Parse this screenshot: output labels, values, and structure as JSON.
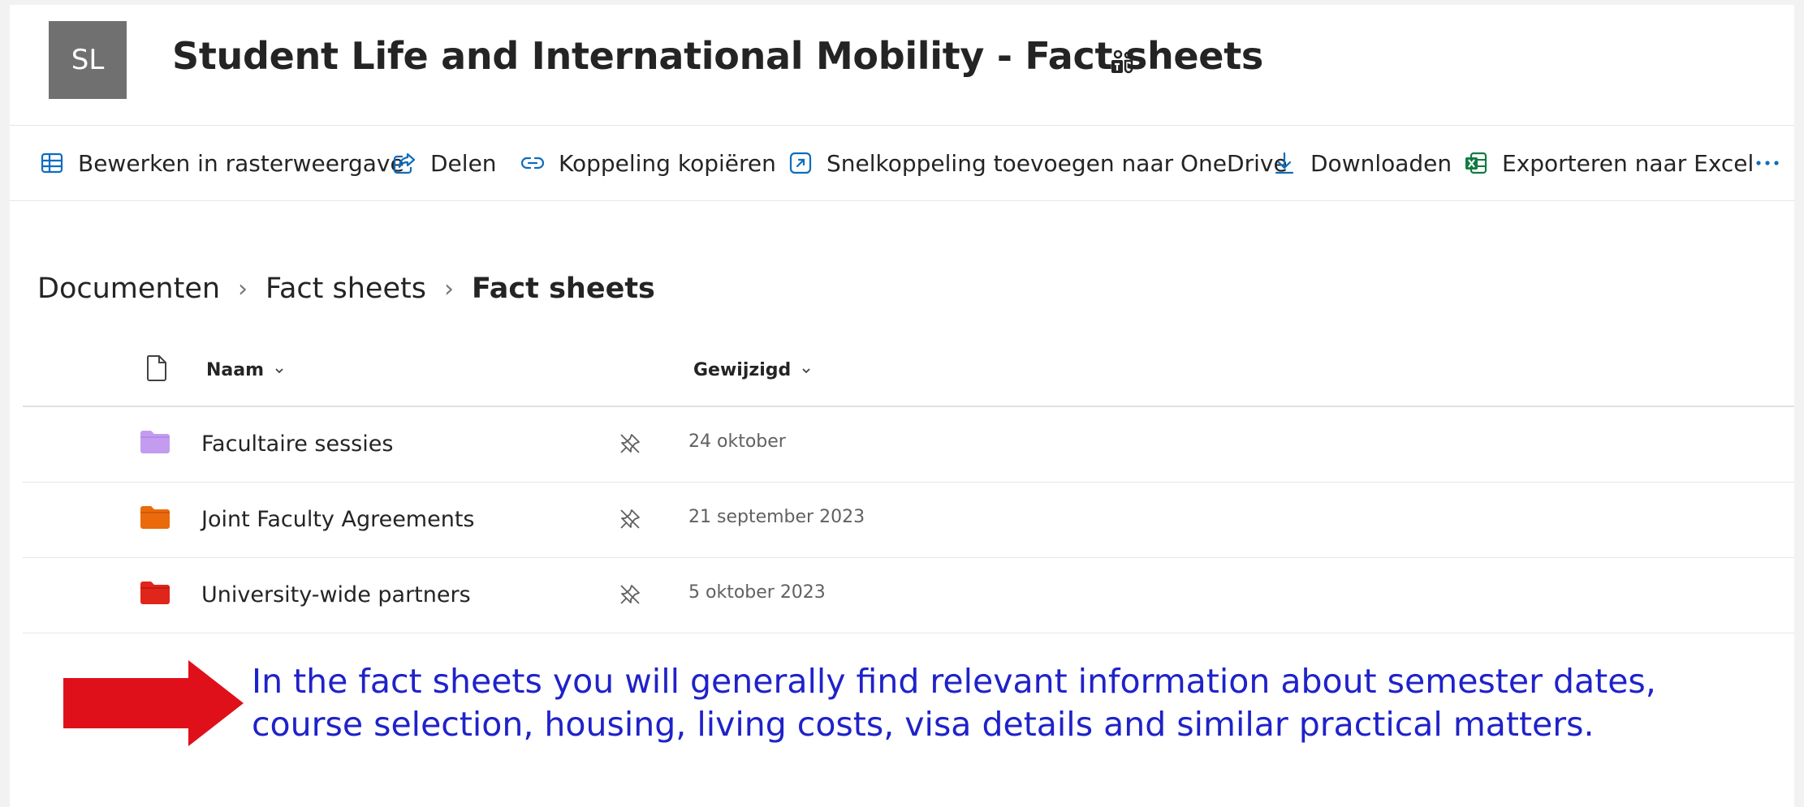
{
  "site": {
    "avatar_initials": "SL",
    "title": "Student Life and International Mobility - Fact sheets",
    "teams_icon": "teams-group-icon"
  },
  "commands": {
    "grid_edit": {
      "label": "Bewerken in rasterweergave",
      "icon": "grid-table-icon"
    },
    "share": {
      "label": "Delen",
      "icon": "share-icon"
    },
    "copy_link": {
      "label": "Koppeling kopiëren",
      "icon": "link-icon"
    },
    "add_shortcut": {
      "label": "Snelkoppeling toevoegen naar OneDrive",
      "icon": "shortcut-icon"
    },
    "download": {
      "label": "Downloaden",
      "icon": "download-icon"
    },
    "export_excel": {
      "label": "Exporteren naar Excel",
      "icon": "excel-icon"
    },
    "more": {
      "label": "···",
      "icon": "more-icon"
    }
  },
  "breadcrumb": {
    "items": [
      "Documenten",
      "Fact sheets"
    ],
    "current": "Fact sheets",
    "separator": "›"
  },
  "list": {
    "columns": {
      "name": "Naam",
      "modified": "Gewijzigd"
    },
    "rows": [
      {
        "name": "Facultaire sessies",
        "modified": "24 oktober",
        "folder_color": "#c39cf0"
      },
      {
        "name": "Joint Faculty Agreements",
        "modified": "21 september 2023",
        "folder_color": "#ea6a0c"
      },
      {
        "name": "University-wide partners",
        "modified": "5 oktober 2023",
        "folder_color": "#e0251b"
      }
    ]
  },
  "annotation": {
    "text": "In the fact sheets you will generally find relevant information about semester dates, course selection, housing, living costs, visa details and similar practical matters.",
    "arrow_color": "#e0101b",
    "text_color": "#1f22c9"
  }
}
